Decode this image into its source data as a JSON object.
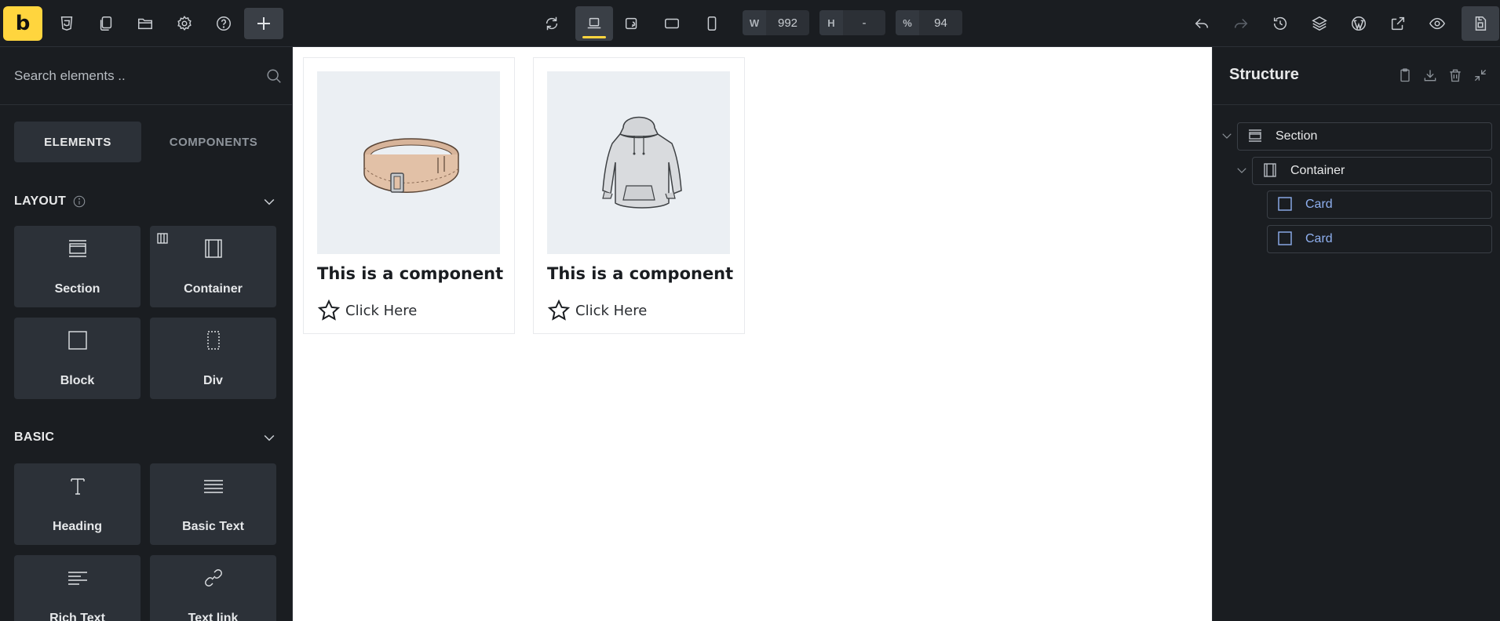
{
  "topbar": {
    "logo": "b",
    "width_label": "W",
    "width_value": "992",
    "height_label": "H",
    "height_value": "-",
    "zoom_label": "%",
    "zoom_value": "94"
  },
  "left": {
    "search_placeholder": "Search elements ..",
    "tabs": [
      "ELEMENTS",
      "COMPONENTS"
    ],
    "groups": {
      "layout": {
        "title": "LAYOUT",
        "items": [
          "Section",
          "Container",
          "Block",
          "Div"
        ]
      },
      "basic": {
        "title": "BASIC",
        "items": [
          "Heading",
          "Basic Text",
          "Rich Text",
          "Text link"
        ]
      }
    }
  },
  "canvas": {
    "cards": [
      {
        "title": "This is a component",
        "link": "Click Here",
        "image": "belt"
      },
      {
        "title": "This is a component",
        "link": "Click Here",
        "image": "hoodie"
      }
    ]
  },
  "structure": {
    "title": "Structure",
    "nodes": [
      "Section",
      "Container",
      "Card",
      "Card"
    ]
  },
  "colors": {
    "brand": "#ffd53e",
    "panel": "#1a1d21",
    "card_link": "#8fb0f0"
  }
}
